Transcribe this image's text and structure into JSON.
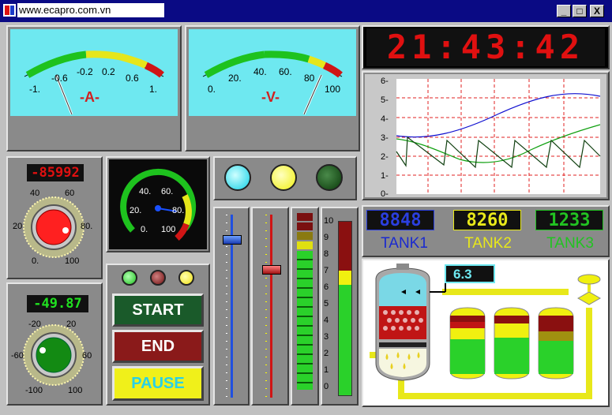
{
  "window": {
    "url": "www.ecapro.com.vn",
    "minimize": "_",
    "maximize": "□",
    "close": "X"
  },
  "ammeter": {
    "ticks": [
      "-1.",
      "-0.6",
      "-0.2",
      "0.2",
      "0.6",
      "1."
    ],
    "unit": "-A-"
  },
  "voltmeter": {
    "ticks": [
      "0.",
      "20.",
      "40.",
      "60.",
      "80",
      "100"
    ],
    "unit": "-V-"
  },
  "clock": {
    "time": "21:43:42"
  },
  "trend": {
    "y_ticks": [
      "6-",
      "5-",
      "4-",
      "3-",
      "2-",
      "1-",
      "0-"
    ]
  },
  "knob1": {
    "display": "-85992",
    "ticks": [
      "40",
      "60",
      "20",
      "80.",
      "0.",
      "100"
    ]
  },
  "gauge": {
    "ticks": [
      "40.",
      "60.",
      "20.",
      "80.",
      "0.",
      "100"
    ]
  },
  "knob2": {
    "display": "-49.87",
    "ticks": [
      "-20",
      "20",
      "-60",
      "60",
      "-100",
      "100"
    ]
  },
  "leds": {
    "small": [
      "green",
      "red",
      "yellow"
    ],
    "large": [
      "cyan",
      "yellow",
      "dark-green"
    ]
  },
  "buttons": {
    "start": "START",
    "end": "END",
    "pause": "PAUSE"
  },
  "bar_scale": [
    "10",
    "9",
    "8",
    "7",
    "6",
    "5",
    "4",
    "3",
    "2",
    "1",
    "0"
  ],
  "tanks": {
    "tank1_value": "8848",
    "tank2_value": "8260",
    "tank3_value": "1233",
    "tank1_label": "TANK1",
    "tank2_label": "TANK2",
    "tank3_label": "TANK3",
    "process_value": "6.3"
  },
  "colors": {
    "title_bar": "#0a0a84",
    "meter_face": "#6ee8f0",
    "lcd_red": "#e01010",
    "green_bar": "#2ad12a",
    "tank1": "#2b3fe0",
    "tank2": "#e8e81a",
    "tank3": "#22c322"
  }
}
